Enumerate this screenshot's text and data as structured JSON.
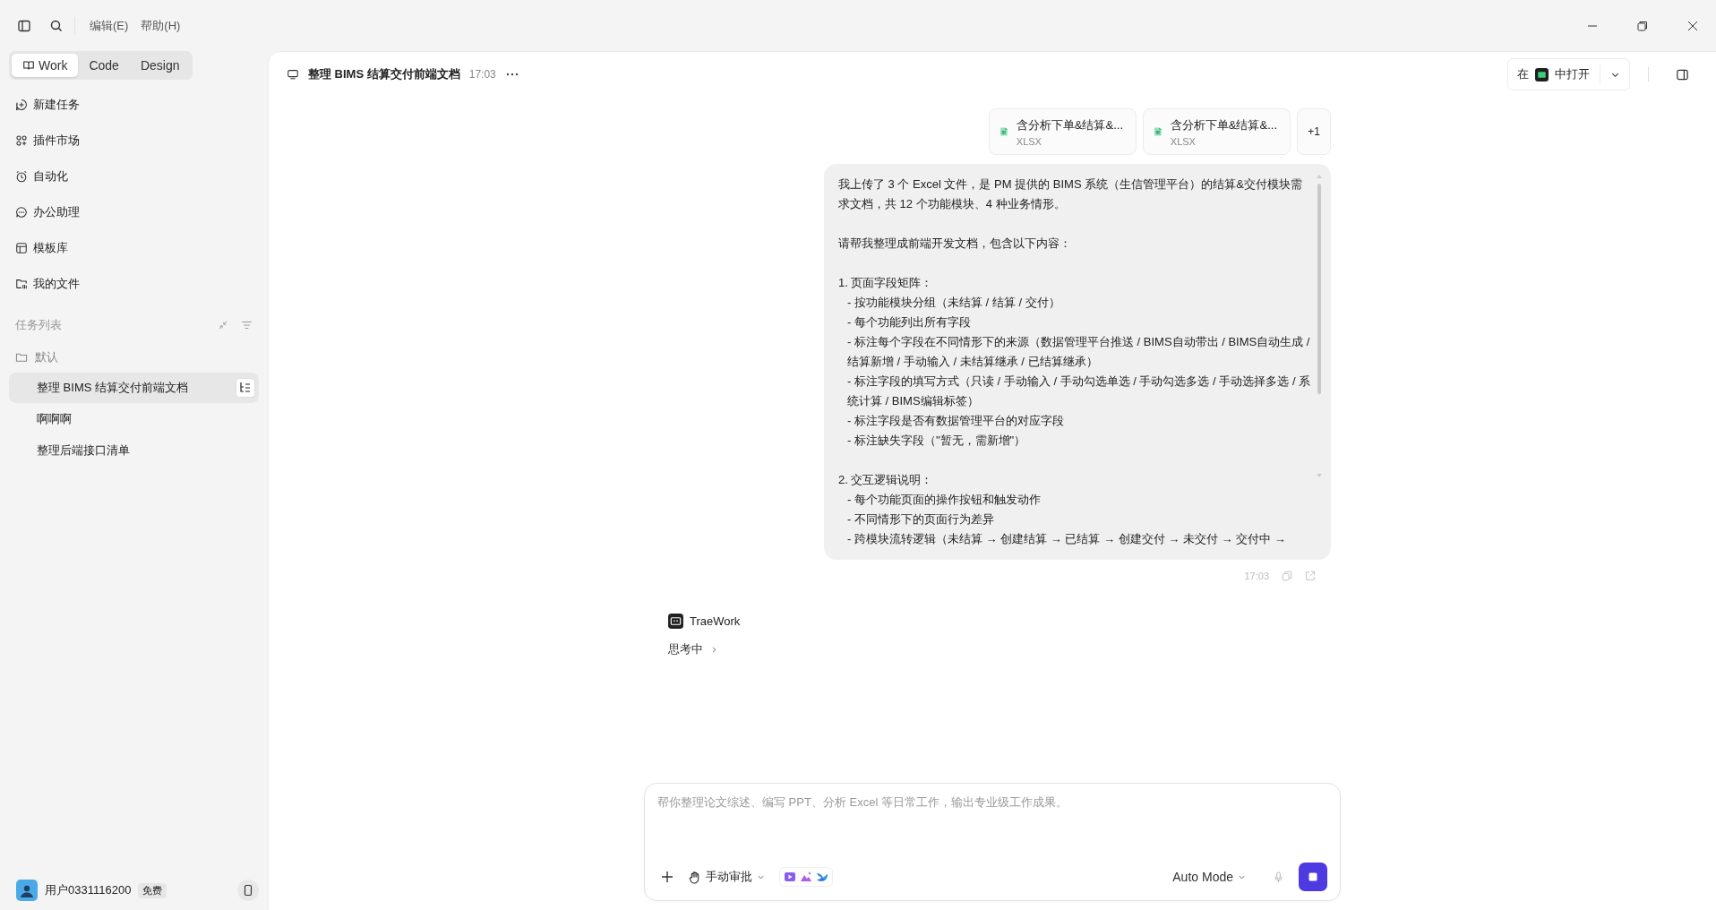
{
  "menu": [
    "编辑(E)",
    "帮助(H)"
  ],
  "modes": [
    {
      "label": "Work",
      "selected": true
    },
    {
      "label": "Code",
      "selected": false
    },
    {
      "label": "Design",
      "selected": false
    }
  ],
  "nav": [
    {
      "label": "新建任务",
      "kind": "new"
    },
    {
      "label": "插件市场",
      "kind": "plugins"
    },
    {
      "label": "自动化",
      "kind": "clock"
    },
    {
      "label": "办公助理",
      "kind": "chat"
    },
    {
      "label": "模板库",
      "kind": "template"
    },
    {
      "label": "我的文件",
      "kind": "files"
    }
  ],
  "task_list": {
    "title": "任务列表",
    "folder": "默认",
    "items": [
      {
        "label": "整理 BIMS 结算交付前端文档",
        "selected": true
      },
      {
        "label": "啊啊啊",
        "selected": false
      },
      {
        "label": "整理后端接口清单",
        "selected": false
      }
    ]
  },
  "user": {
    "name": "用户0331116200",
    "badge": "免费"
  },
  "header": {
    "title": "整理 BIMS 结算交付前端文档",
    "time": "17:03",
    "open_prefix": "在",
    "open_suffix": "中打开"
  },
  "attachments": [
    {
      "name": "含分析下单&结算&...",
      "type": "XLSX"
    },
    {
      "name": "含分析下单&结算&...",
      "type": "XLSX"
    }
  ],
  "more_attachments": "+1",
  "message": [
    [
      {
        "text": "我上传了 3 个 Excel 文件，是 PM 提供的 BIMS 系统（生信管理平台）的结算&交付模块需求文档，共 12 个功能模块、4 种业务情形。",
        "kind": "plain"
      }
    ],
    [
      {
        "text": "请帮我整理成前端开发文档，包含以下内容：",
        "kind": "plain"
      }
    ],
    [
      {
        "text": "1. 页面字段矩阵：",
        "kind": "plain"
      },
      {
        "text": "- 按功能模块分组（未结算 / 结算 / 交付）",
        "kind": "item"
      },
      {
        "text": "- 每个功能列出所有字段",
        "kind": "item"
      },
      {
        "text": "- 标注每个字段在不同情形下的来源（数据管理平台推送 / BIMS自动带出 / BIMS自动生成 / 结算新增 / 手动输入 / 未结算继承 / 已结算继承）",
        "kind": "item"
      },
      {
        "text": "- 标注字段的填写方式（只读 / 手动输入 / 手动勾选单选 / 手动勾选多选 / 手动选择多选 / 系统计算 / BIMS编辑标签）",
        "kind": "item"
      },
      {
        "text": "- 标注字段是否有数据管理平台的对应字段",
        "kind": "item"
      },
      {
        "text": "- 标注缺失字段（\"暂无，需新增\"）",
        "kind": "item"
      }
    ],
    [
      {
        "text": "2. 交互逻辑说明：",
        "kind": "plain"
      },
      {
        "text": "- 每个功能页面的操作按钮和触发动作",
        "kind": "item"
      },
      {
        "text": "- 不同情形下的页面行为差异",
        "kind": "item"
      },
      {
        "text": "- 跨模块流转逻辑（未结算 → 创建结算 → 已结算 → 创建交付 → 未交付 → 交付中 →",
        "kind": "item"
      }
    ]
  ],
  "message_time": "17:03",
  "assistant": {
    "name": "TraeWork",
    "status": "思考中"
  },
  "composer": {
    "placeholder": "帮你整理论文综述、编写 PPT、分析 Excel 等日常工作，输出专业级工作成果。",
    "approval": "手动审批",
    "mode": "Auto Mode"
  }
}
